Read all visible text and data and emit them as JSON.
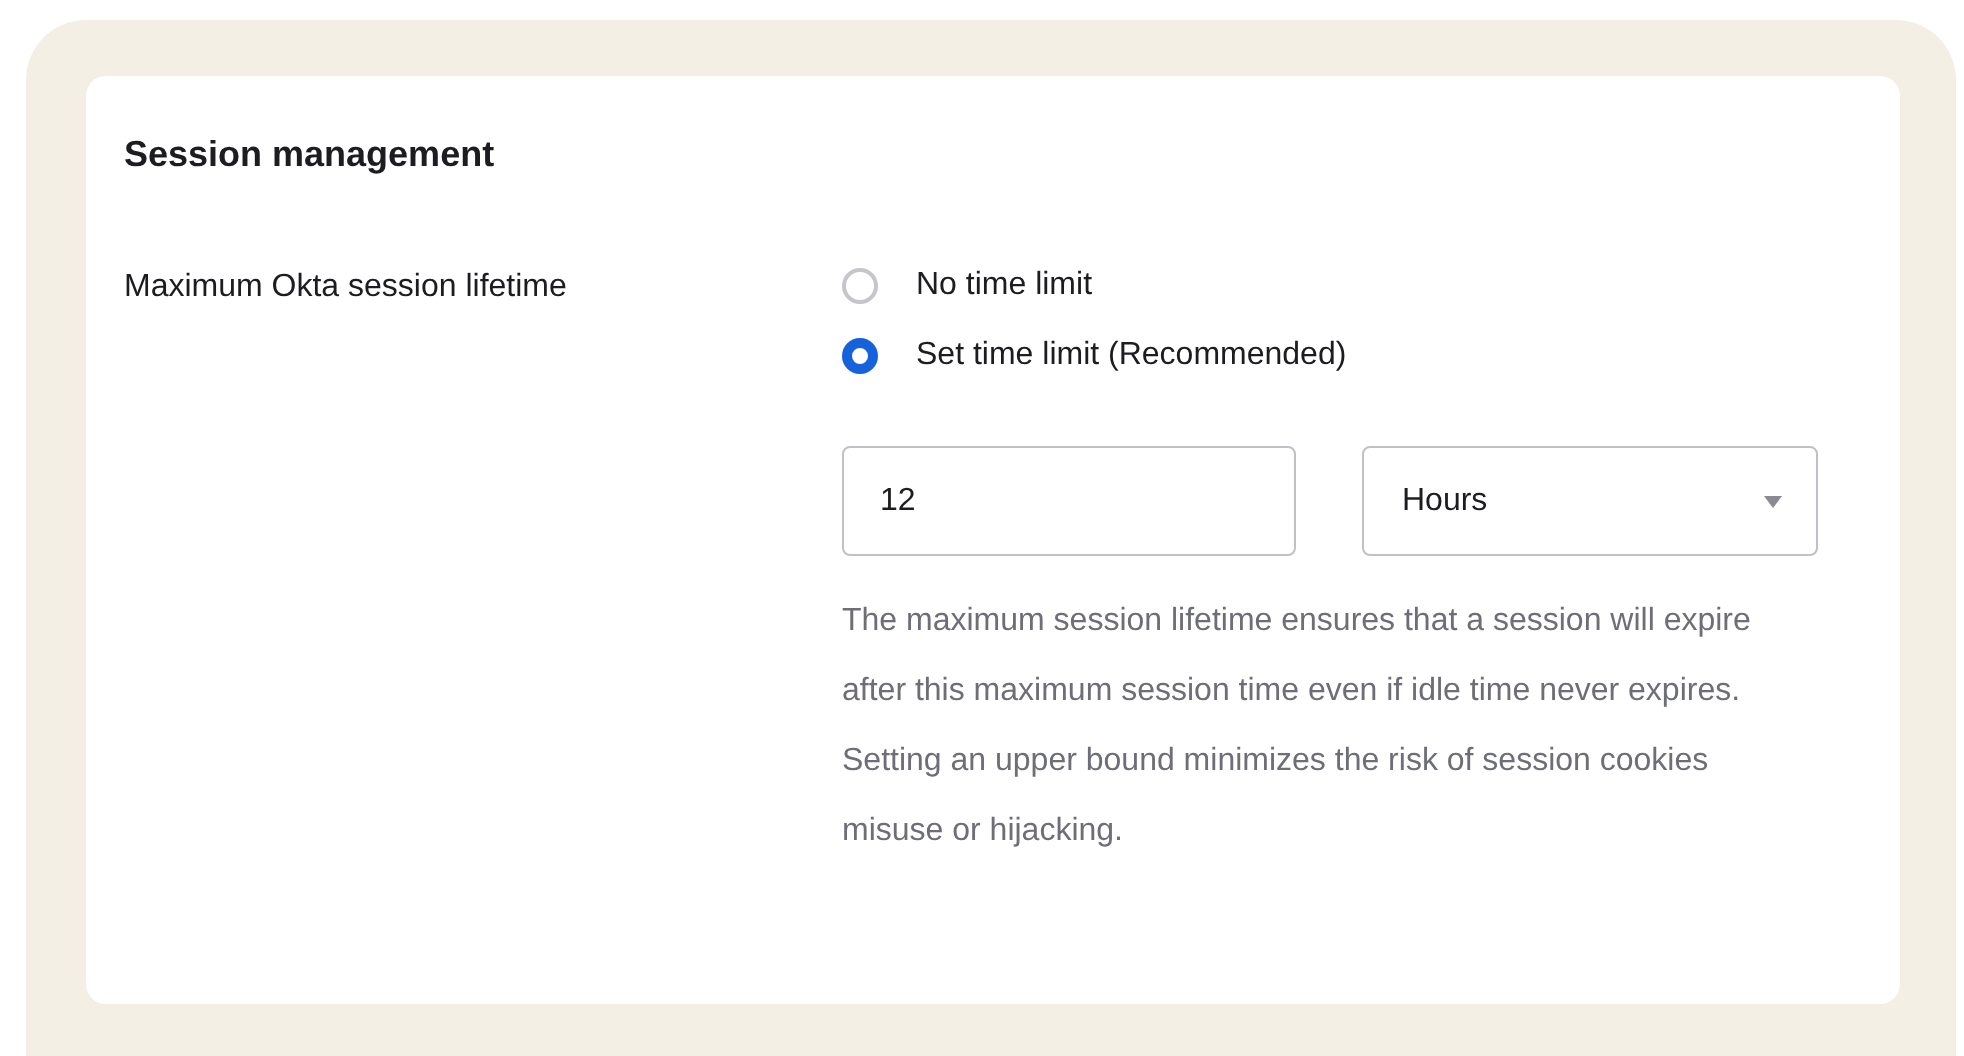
{
  "section": {
    "title": "Session management",
    "field_label": "Maximum Okta session lifetime",
    "options": [
      {
        "label": "No time limit",
        "selected": false
      },
      {
        "label": "Set time limit (Recommended)",
        "selected": true
      }
    ],
    "amount": {
      "value": "12"
    },
    "unit": {
      "value": "Hours"
    },
    "help": "The maximum session lifetime ensures that a session will expire after this maximum session time even if idle time never expires. Setting an upper bound minimizes the risk of session cookies misuse or hijacking."
  }
}
